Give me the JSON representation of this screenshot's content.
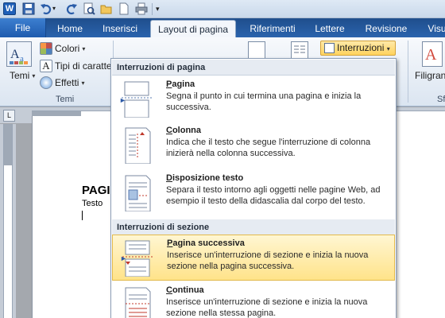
{
  "window": {
    "app_logo": "W",
    "qat_icons": [
      "save-icon",
      "undo-icon",
      "redo-icon",
      "print-preview-icon",
      "open-icon",
      "new-icon",
      "print-icon",
      "customize-icon"
    ]
  },
  "tabs": [
    {
      "label": "File"
    },
    {
      "label": "Home"
    },
    {
      "label": "Inserisci"
    },
    {
      "label": "Layout di pagina",
      "active": true
    },
    {
      "label": "Riferimenti"
    },
    {
      "label": "Lettere"
    },
    {
      "label": "Revisione"
    },
    {
      "label": "Visu"
    }
  ],
  "ribbon": {
    "temi_label": "Temi",
    "colori_label": "Colori",
    "tipi_label": "Tipi di caratte",
    "effetti_label": "Effetti",
    "group_temi": "Temi",
    "interruzioni_label": "Interruzioni",
    "filigrana_label": "Filigran",
    "right_group": "Sf"
  },
  "document": {
    "heading": "PAGI",
    "text": "Testo "
  },
  "menu": {
    "section1": "Interruzioni di pagina",
    "section2": "Interruzioni di sezione",
    "items": [
      {
        "title": "Pagina",
        "accel": "P",
        "rest": "agina",
        "desc": "Segna il punto in cui termina una pagina e inizia la successiva."
      },
      {
        "title": "Colonna",
        "accel": "C",
        "rest": "olonna",
        "desc": "Indica che il testo che segue l'interruzione di colonna inizierà nella colonna successiva."
      },
      {
        "title": "Disposizione testo",
        "accel": "D",
        "rest": "isposizione testo",
        "desc": "Separa il testo intorno agli oggetti nelle pagine Web, ad esempio il testo della didascalia dal corpo del testo."
      },
      {
        "title": "Pagina successiva",
        "accel": "P",
        "rest": "agina successiva",
        "desc": "Inserisce un'interruzione di sezione e inizia la nuova sezione nella pagina successiva."
      },
      {
        "title": "Continua",
        "accel": "C",
        "rest": "ontinua",
        "desc": "Inserisce un'interruzione di sezione e inizia la nuova sezione nella stessa pagina."
      }
    ]
  },
  "colors": {
    "accent": "#2a63ad",
    "highlight": "#ffe38a",
    "section_red": "#c0392b"
  }
}
